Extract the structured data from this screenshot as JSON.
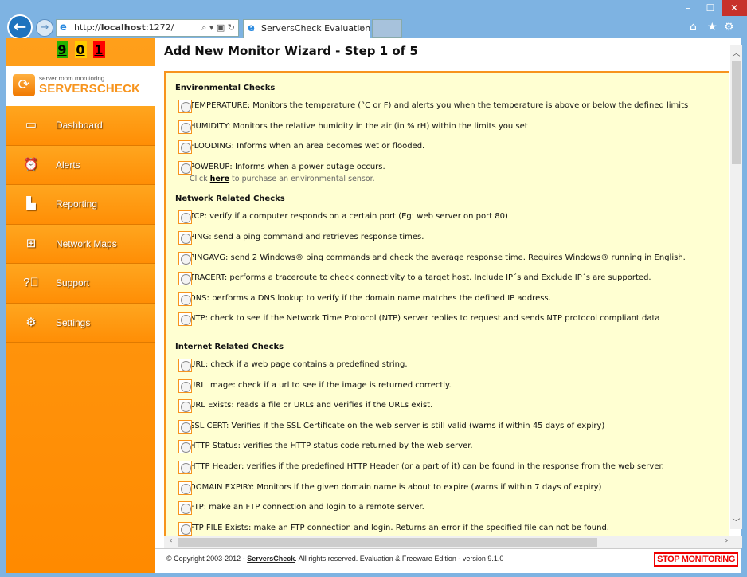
{
  "browser": {
    "url_prefix": "http://",
    "url_host": "localhost",
    "url_port": ":1272/",
    "tab_title": "ServersCheck Evaluation & ...",
    "window_controls": {
      "minimize": "–",
      "maximize": "☐",
      "close": "✕"
    }
  },
  "sidebar": {
    "counters": [
      {
        "value": "9",
        "color": "#22b100"
      },
      {
        "value": "0",
        "color": "#ffcc00"
      },
      {
        "value": "1",
        "color": "#ff0000"
      }
    ],
    "logo": {
      "tagline": "server room monitoring",
      "brand": "SERVERSCHECK"
    },
    "items": [
      {
        "label": "Dashboard",
        "icon": "monitor-icon"
      },
      {
        "label": "Alerts",
        "icon": "alarm-clock-icon"
      },
      {
        "label": "Reporting",
        "icon": "bar-chart-icon"
      },
      {
        "label": "Network Maps",
        "icon": "network-icon"
      },
      {
        "label": "Support",
        "icon": "help-icon"
      },
      {
        "label": "Settings",
        "icon": "gear-icon"
      }
    ]
  },
  "main": {
    "title": "Add New Monitor Wizard - Step 1 of 5",
    "environmental": {
      "heading": "Environmental Checks",
      "items": [
        "TEMPERATURE: Monitors the temperature (°C or F) and alerts you when the temperature is above or below the defined limits",
        "HUMIDITY: Monitors the relative humidity in the air (in % rH) within the limits you set",
        "FLOODING: Informs when an area becomes wet or flooded.",
        "POWERUP: Informs when a power outage occurs."
      ],
      "note_pre": "Click ",
      "note_link": "here",
      "note_post": " to purchase an environmental sensor."
    },
    "network": {
      "heading": "Network Related Checks",
      "items": [
        "TCP: verify if a computer responds on a certain port (Eg: web server on port 80)",
        "PING: send a ping command and retrieves response times.",
        "PINGAVG: send 2 Windows® ping commands and check the average response time. Requires Windows® running in English.",
        "TRACERT: performs a traceroute to check connectivity to a target host. Include IP´s and Exclude IP´s are supported.",
        "DNS: performs a DNS lookup to verify if the domain name matches the defined IP address.",
        "NTP: check to see if the Network Time Protocol (NTP) server replies to request and sends NTP protocol compliant data"
      ]
    },
    "internet": {
      "heading": "Internet Related Checks",
      "items": [
        "URL: check if a web page contains a predefined string.",
        "URL Image: check if a url to see if the image is returned correctly.",
        "URL Exists: reads a file or URLs and verifies if the URLs exist.",
        "SSL CERT: Verifies if the SSL Certificate on the web server is still valid (warns if within 45 days of expiry)",
        "HTTP Status: verifies the HTTP status code returned by the web server.",
        "HTTP Header: verifies if the predefined HTTP Header (or a part of it) can be found in the response from the web server.",
        "DOMAIN EXPIRY: Monitors if the given domain name is about to expire (warns if within 7 days of expiry)",
        "FTP: make an FTP connection and login to a remote server.",
        "FTP FILE Exists: make an FTP connection and login. Returns an error if the specified file can not be found."
      ]
    }
  },
  "footer": {
    "copy_pre": "© Copyright 2003-2012 - ",
    "copy_link": "ServersCheck",
    "copy_post": ". All rights reserved. Evaluation & Freeware Edition - version 9.1.0",
    "stop_label": "STOP MONITORING"
  }
}
